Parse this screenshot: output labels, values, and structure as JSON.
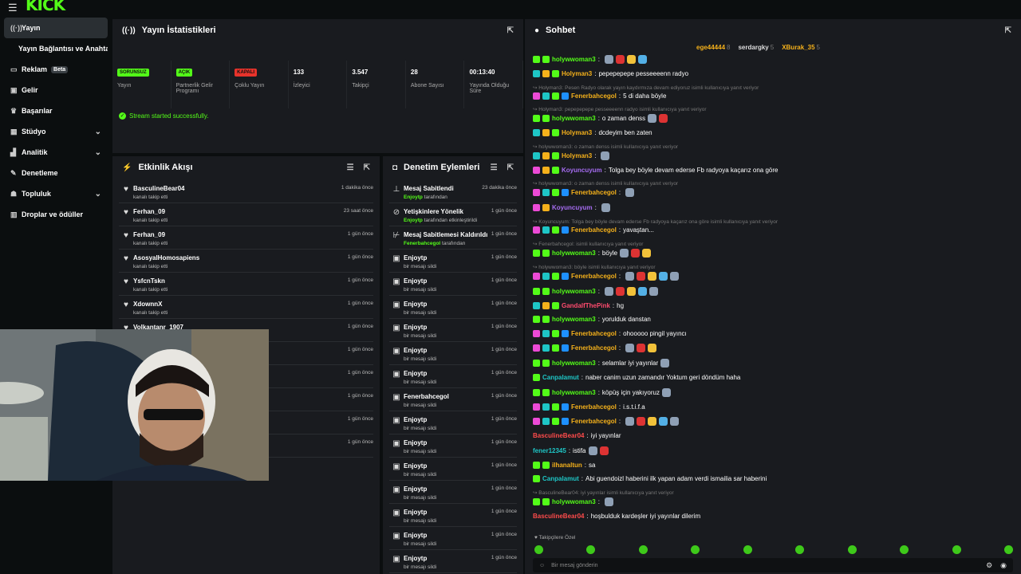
{
  "brand": {
    "logo": "KICK"
  },
  "sidebar": {
    "items": [
      {
        "label": "Yayın",
        "icon": "stream-icon",
        "active": true
      },
      {
        "label": "Yayın Bağlantısı ve Anahtarı",
        "icon": ""
      },
      {
        "label": "Reklam",
        "icon": "ad-icon",
        "badge": "Beta"
      },
      {
        "label": "Gelir",
        "icon": "money-icon"
      },
      {
        "label": "Başarılar",
        "icon": "trophy-icon"
      },
      {
        "label": "Stüdyo",
        "icon": "studio-icon",
        "chevron": true
      },
      {
        "label": "Analitik",
        "icon": "chart-icon",
        "chevron": true
      },
      {
        "label": "Denetleme",
        "icon": "wrench-icon"
      },
      {
        "label": "Topluluk",
        "icon": "community-icon",
        "chevron": true
      },
      {
        "label": "Droplar ve ödüller",
        "icon": "gift-icon"
      }
    ]
  },
  "stats_panel": {
    "title": "Yayın İstatistikleri",
    "stats": [
      {
        "tag": "SORUNSUZ",
        "tag_color": "#53fc18",
        "label": "Yayın"
      },
      {
        "tag": "AÇIK",
        "tag_color": "#53fc18",
        "label": "Partnerlik Gelir Programı"
      },
      {
        "tag": "KAPALI",
        "tag_color": "#e8332b",
        "label": "Çoklu Yayın"
      },
      {
        "num": "133",
        "label": "İzleyici"
      },
      {
        "num": "3.547",
        "label": "Takipçi"
      },
      {
        "num": "28",
        "label": "Abone Sayısı"
      },
      {
        "num": "00:13:40",
        "label": "Yayında Olduğu Süre"
      }
    ],
    "success": "Stream started successfully."
  },
  "activity": {
    "title": "Etkinlik Akışı",
    "rows": [
      {
        "name": "BasculineBear04",
        "sub": "kanalı takip etti",
        "time": "1 dakika önce"
      },
      {
        "name": "Ferhan_09",
        "sub": "kanalı takip etti",
        "time": "23 saat önce"
      },
      {
        "name": "Ferhan_09",
        "sub": "kanalı takip etti",
        "time": "1 gün önce"
      },
      {
        "name": "AsosyalHomosapiens",
        "sub": "kanalı takip etti",
        "time": "1 gün önce"
      },
      {
        "name": "YsfcnTskn",
        "sub": "kanalı takip etti",
        "time": "1 gün önce"
      },
      {
        "name": "XdownnX",
        "sub": "kanalı takip etti",
        "time": "1 gün önce"
      },
      {
        "name": "Volkantanr_1907",
        "sub": "",
        "time": "1 gün önce"
      },
      {
        "name": "",
        "sub": "",
        "time": "1 gün önce"
      },
      {
        "name": "",
        "sub": "",
        "time": "1 gün önce"
      },
      {
        "name": "",
        "sub": "",
        "time": "1 gün önce"
      },
      {
        "name": "",
        "sub": "",
        "time": "1 gün önce"
      },
      {
        "name": "",
        "sub": "",
        "time": "1 gün önce"
      }
    ]
  },
  "moderation": {
    "title": "Denetim Eylemleri",
    "rows": [
      {
        "name": "Mesaj Sabitlendi",
        "actor": "Enjoytp",
        "sub": " tarafından",
        "time": "23 dakika önce",
        "icon": "pin-icon"
      },
      {
        "name": "Yetişkinlere Yönelik",
        "actor": "Enjoytp",
        "sub": " tarafından etkinleştirildi",
        "time": "1 gün önce",
        "icon": "eye-off-icon"
      },
      {
        "name": "Mesaj Sabitlemesi Kaldırıldı",
        "actor": "Fenerbahcegol",
        "sub": " tarafından",
        "time": "1 gün önce",
        "icon": "unpin-icon"
      },
      {
        "name": "Enjoytp",
        "sub": "bir mesajı sildi",
        "time": "1 gün önce",
        "icon": "trash-icon"
      },
      {
        "name": "Enjoytp",
        "sub": "bir mesajı sildi",
        "time": "1 gün önce",
        "icon": "trash-icon"
      },
      {
        "name": "Enjoytp",
        "sub": "bir mesajı sildi",
        "time": "1 gün önce",
        "icon": "trash-icon"
      },
      {
        "name": "Enjoytp",
        "sub": "bir mesajı sildi",
        "time": "1 gün önce",
        "icon": "trash-icon"
      },
      {
        "name": "Enjoytp",
        "sub": "bir mesajı sildi",
        "time": "1 gün önce",
        "icon": "trash-icon"
      },
      {
        "name": "Enjoytp",
        "sub": "bir mesajı sildi",
        "time": "1 gün önce",
        "icon": "trash-icon"
      },
      {
        "name": "Fenerbahcegol",
        "sub": "bir mesajı sildi",
        "time": "1 gün önce",
        "icon": "trash-icon"
      },
      {
        "name": "Enjoytp",
        "sub": "bir mesajı sildi",
        "time": "1 gün önce",
        "icon": "trash-icon"
      },
      {
        "name": "Enjoytp",
        "sub": "bir mesajı sildi",
        "time": "1 gün önce",
        "icon": "trash-icon"
      },
      {
        "name": "Enjoytp",
        "sub": "bir mesajı sildi",
        "time": "1 gün önce",
        "icon": "trash-icon"
      },
      {
        "name": "Enjoytp",
        "sub": "bir mesajı sildi",
        "time": "1 gün önce",
        "icon": "trash-icon"
      },
      {
        "name": "Enjoytp",
        "sub": "bir mesajı sildi",
        "time": "1 gün önce",
        "icon": "trash-icon"
      },
      {
        "name": "Enjoytp",
        "sub": "bir mesajı sildi",
        "time": "1 gün önce",
        "icon": "trash-icon"
      },
      {
        "name": "Enjoytp",
        "sub": "bir mesajı sildi",
        "time": "1 gün önce",
        "icon": "trash-icon"
      }
    ]
  },
  "chat": {
    "title": "Sohbet",
    "pinned": [
      {
        "name": "ege44444",
        "count": "8",
        "color": "#f5b11b"
      },
      {
        "name": "serdargky",
        "count": "5",
        "color": "#ddd"
      },
      {
        "name": "XBurak_35",
        "count": "5",
        "color": "#f5b11b"
      }
    ],
    "lines": [
      {
        "type": "msg",
        "user": "holywwoman3",
        "color": "#53fc18",
        "text": "",
        "emotes": 4,
        "badges": [
          "#53fc18",
          "#53fc18"
        ]
      },
      {
        "type": "msg",
        "user": "Holyman3",
        "color": "#f5b11b",
        "text": "pepepepepe pesseeeenn radyo",
        "badges": [
          "#1ec6c6",
          "#f5b11b",
          "#53fc18"
        ]
      },
      {
        "type": "reply",
        "text": "↪ Holyman3: Pesen Radyo olarak yayın kaydırmıza devam ediyoruz isimli kullanıcıya yanıt veriyor"
      },
      {
        "type": "msg",
        "user": "Fenerbahcegol",
        "color": "#f5b11b",
        "text": "5 di daha böyle",
        "badges": [
          "#ec4ad6",
          "#1ec6c6",
          "#53fc18",
          "#1e90ff"
        ]
      },
      {
        "type": "reply",
        "text": "↪ Holyman3: pepepepepe pesseeeenn radyo isimli kullanıcıya yanıt veriyor"
      },
      {
        "type": "msg",
        "user": "holywwoman3",
        "color": "#53fc18",
        "text": "o zaman denss",
        "emotes": 2,
        "badges": [
          "#53fc18",
          "#53fc18"
        ]
      },
      {
        "type": "msg",
        "user": "Holyman3",
        "color": "#f5b11b",
        "text": "dcdeyim ben zaten",
        "badges": [
          "#1ec6c6",
          "#f5b11b",
          "#53fc18"
        ]
      },
      {
        "type": "reply",
        "text": "↪ holywwoman3: o zaman denss isimli kullanıcıya yanıt veriyor"
      },
      {
        "type": "msg",
        "user": "Holyman3",
        "color": "#f5b11b",
        "text": "",
        "emotes": 1,
        "badges": [
          "#1ec6c6",
          "#f5b11b",
          "#53fc18"
        ]
      },
      {
        "type": "msg",
        "user": "Koyuncuyum",
        "color": "#a56cf0",
        "text": "Tolga bey böyle devam ederse Fb radyoya kaçarız ona göre",
        "badges": [
          "#ec4ad6",
          "#f5b11b",
          "#53fc18"
        ]
      },
      {
        "type": "reply",
        "text": "↪ holywwoman3: o zaman denss isimli kullanıcıya yanıt veriyor"
      },
      {
        "type": "msg",
        "user": "Fenerbahcegol",
        "color": "#f5b11b",
        "text": "",
        "emotes": 1,
        "badges": [
          "#ec4ad6",
          "#1ec6c6",
          "#53fc18",
          "#1e90ff"
        ]
      },
      {
        "type": "msg",
        "user": "Koyuncuyum",
        "color": "#a56cf0",
        "text": "",
        "emotes": 1,
        "badges": [
          "#ec4ad6",
          "#f5b11b"
        ]
      },
      {
        "type": "reply",
        "text": "↪ Koyuncuyum: Tolga bey böyle devam ederse Fb radyoya kaçarız ona göre isimli kullanıcıya yanıt veriyor"
      },
      {
        "type": "msg",
        "user": "Fenerbahcegol",
        "color": "#f5b11b",
        "text": "yavaştan...",
        "badges": [
          "#ec4ad6",
          "#1ec6c6",
          "#53fc18",
          "#1e90ff"
        ]
      },
      {
        "type": "reply",
        "text": "↪ Fenerbahcegol: isimli kullanıcıya yanıt veriyor"
      },
      {
        "type": "msg",
        "user": "holywwoman3",
        "color": "#53fc18",
        "text": "böyle",
        "emotes": 3,
        "badges": [
          "#53fc18",
          "#53fc18"
        ]
      },
      {
        "type": "reply",
        "text": "↪ holywwoman3: böyle isimli kullanıcıya yanıt veriyor"
      },
      {
        "type": "msg",
        "user": "Fenerbahcegol",
        "color": "#f5b11b",
        "text": "",
        "emotes": 5,
        "badges": [
          "#ec4ad6",
          "#1ec6c6",
          "#53fc18",
          "#1e90ff"
        ]
      },
      {
        "type": "msg",
        "user": "holywwoman3",
        "color": "#53fc18",
        "text": "",
        "emotes": 5,
        "badges": [
          "#53fc18",
          "#53fc18"
        ]
      },
      {
        "type": "msg",
        "user": "GandalfThePink",
        "color": "#ff4b6e",
        "text": "hg",
        "badges": [
          "#1ec6c6",
          "#f5b11b",
          "#53fc18"
        ]
      },
      {
        "type": "msg",
        "user": "holywwoman3",
        "color": "#53fc18",
        "text": "yorulduk danstan",
        "badges": [
          "#53fc18",
          "#53fc18"
        ]
      },
      {
        "type": "msg",
        "user": "Fenerbahcegol",
        "color": "#f5b11b",
        "text": "ohooooo pingil yayıncı",
        "badges": [
          "#ec4ad6",
          "#1ec6c6",
          "#53fc18",
          "#1e90ff"
        ]
      },
      {
        "type": "msg",
        "user": "Fenerbahcegol",
        "color": "#f5b11b",
        "text": "",
        "emotes": 3,
        "badges": [
          "#ec4ad6",
          "#1ec6c6",
          "#53fc18",
          "#1e90ff"
        ]
      },
      {
        "type": "msg",
        "user": "holywwoman3",
        "color": "#53fc18",
        "text": "selamlar iyi yayınlar",
        "emotes": 1,
        "badges": [
          "#53fc18",
          "#53fc18"
        ]
      },
      {
        "type": "msg",
        "user": "Canpalamut",
        "color": "#1ec6c6",
        "text": "naber canim uzun zamandır Yoktum geri döndüm haha",
        "badges": [
          "#53fc18"
        ]
      },
      {
        "type": "msg",
        "user": "holywwoman3",
        "color": "#53fc18",
        "text": "köpüş için yakıyoruz",
        "emotes": 1,
        "badges": [
          "#53fc18",
          "#53fc18"
        ]
      },
      {
        "type": "msg",
        "user": "Fenerbahcegol",
        "color": "#f5b11b",
        "text": "i.s.t.i.f.a",
        "badges": [
          "#ec4ad6",
          "#1ec6c6",
          "#53fc18",
          "#1e90ff"
        ]
      },
      {
        "type": "msg",
        "user": "Fenerbahcegol",
        "color": "#f5b11b",
        "text": "",
        "emotes": 5,
        "badges": [
          "#ec4ad6",
          "#1ec6c6",
          "#53fc18",
          "#1e90ff"
        ]
      },
      {
        "type": "msg",
        "user": "BasculineBear04",
        "color": "#ff4b4b",
        "text": "iyi yayınlar",
        "badges": []
      },
      {
        "type": "msg",
        "user": "fener12345",
        "color": "#1ec6c6",
        "text": "istifa",
        "emotes": 2,
        "badges": []
      },
      {
        "type": "msg",
        "user": "ilhanaltun",
        "color": "#f5b11b",
        "text": "sa",
        "badges": [
          "#53fc18",
          "#53fc18"
        ]
      },
      {
        "type": "msg",
        "user": "Canpalamut",
        "color": "#1ec6c6",
        "text": "Abi guendoizl haberini ilk yapan adam verdi ismailia sar haberini",
        "badges": [
          "#53fc18"
        ]
      },
      {
        "type": "reply",
        "text": "↪ BasculineBear04: iyi yayınlar isimli kullanıcıya yanıt veriyor"
      },
      {
        "type": "msg",
        "user": "holywwoman3",
        "color": "#53fc18",
        "text": "",
        "emotes": 1,
        "badges": [
          "#53fc18",
          "#53fc18"
        ]
      },
      {
        "type": "msg",
        "user": "BasculineBear04",
        "color": "#ff4b4b",
        "text": "hoşbulduk kardeşler iyi yayınlar dilerim",
        "badges": []
      }
    ],
    "followers_label": "♥ Takipçilere Özel",
    "input_placeholder": "Bir mesaj gönderin"
  }
}
